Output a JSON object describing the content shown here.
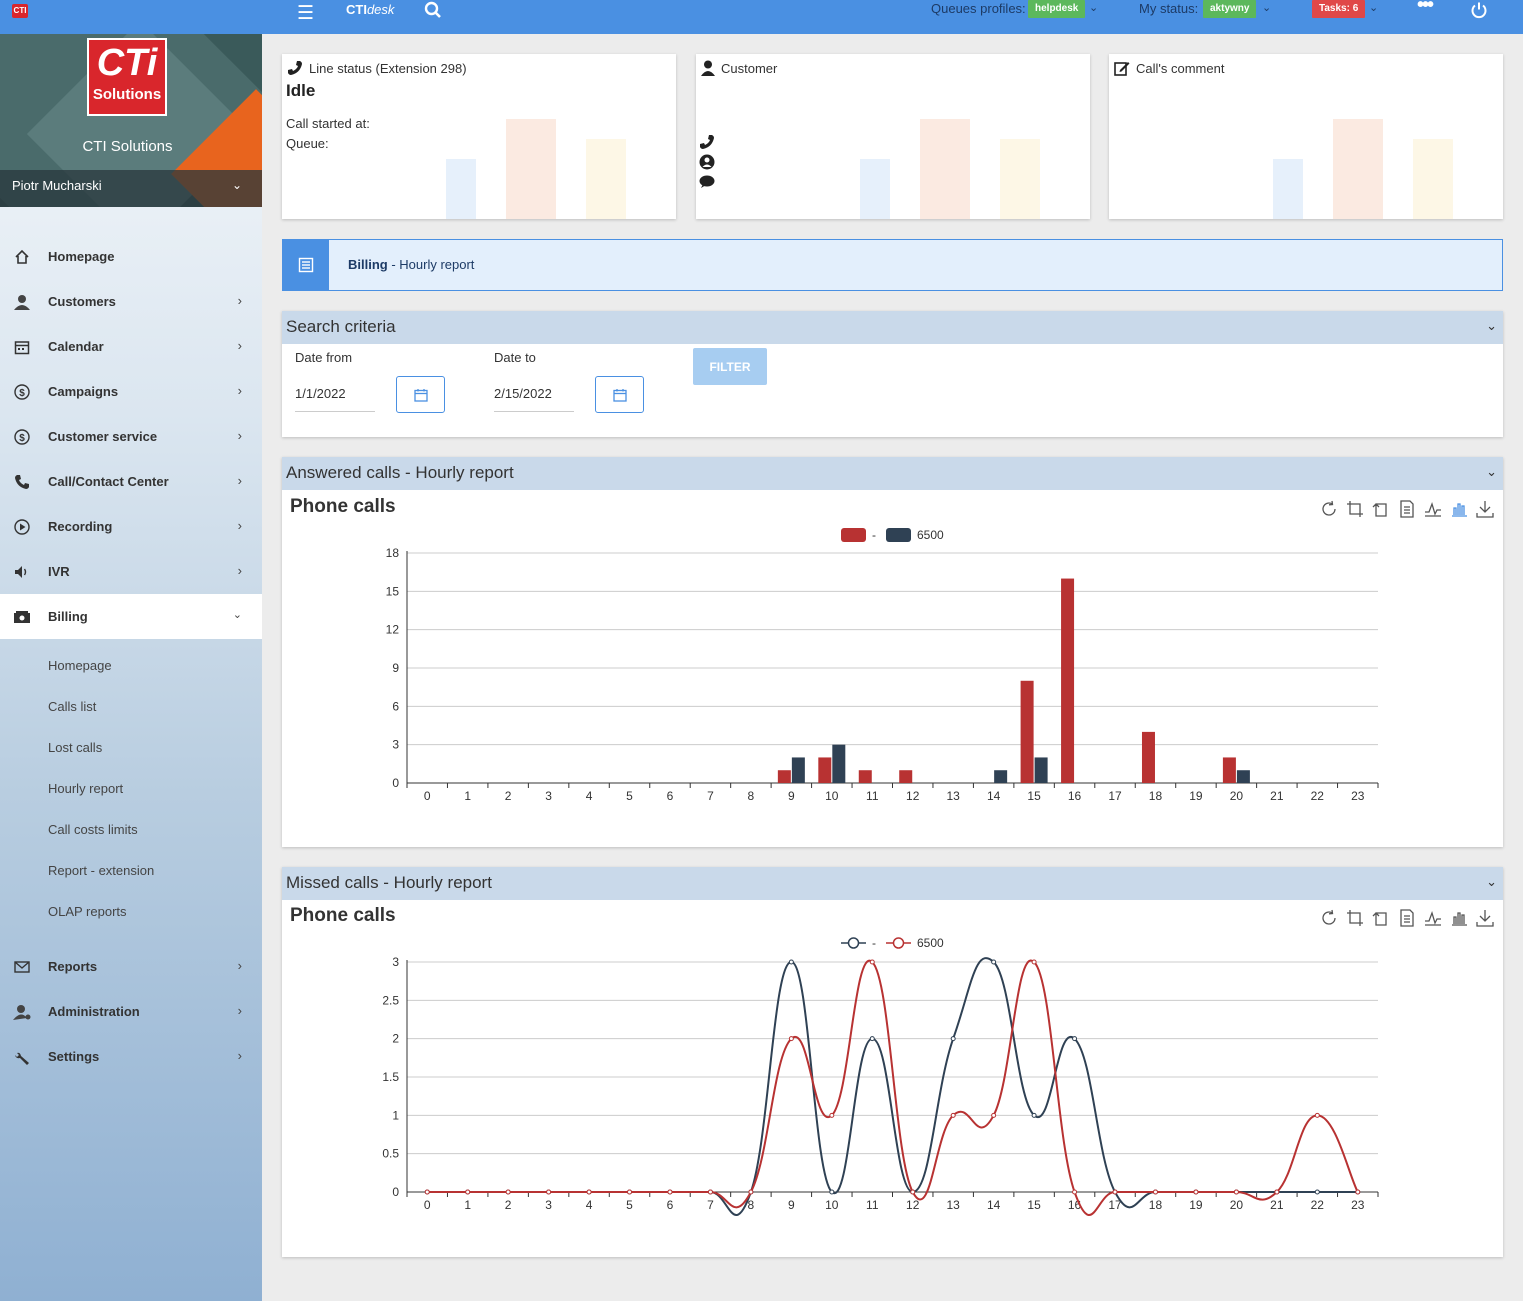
{
  "topbar": {
    "logo_text": "CTI",
    "brand_bold": "CTI",
    "brand_italic": "desk",
    "queues_label": "Queues profiles:",
    "queues_value": "helpdesk",
    "status_label": "My status:",
    "status_value": "aktywny",
    "tasks": "Tasks: 6",
    "colors": {
      "bar": "#4a90e2",
      "green": "#5cb85c",
      "red": "#e04848"
    }
  },
  "sidebar": {
    "logo_big": "CTi",
    "logo_small": "Solutions",
    "company": "CTI Solutions",
    "user": "Piotr Mucharski",
    "items": [
      {
        "label": "Homepage",
        "icon": "home-icon",
        "arrow": false
      },
      {
        "label": "Customers",
        "icon": "user-icon",
        "arrow": true
      },
      {
        "label": "Calendar",
        "icon": "calendar-icon",
        "arrow": true
      },
      {
        "label": "Campaigns",
        "icon": "dollar-icon",
        "arrow": true
      },
      {
        "label": "Customer service",
        "icon": "dollar-icon",
        "arrow": true
      },
      {
        "label": "Call/Contact Center",
        "icon": "phone-icon",
        "arrow": true
      },
      {
        "label": "Recording",
        "icon": "play-icon",
        "arrow": true
      },
      {
        "label": "IVR",
        "icon": "speaker-icon",
        "arrow": true
      },
      {
        "label": "Billing",
        "icon": "money-icon",
        "arrow": false
      }
    ],
    "billing_sub": [
      "Homepage",
      "Calls list",
      "Lost calls",
      "Hourly report",
      "Call costs limits",
      "Report - extension",
      "OLAP reports"
    ],
    "bottom_items": [
      {
        "label": "Reports",
        "icon": "mail-icon"
      },
      {
        "label": "Administration",
        "icon": "user-admin-icon"
      },
      {
        "label": "Settings",
        "icon": "wrench-icon"
      }
    ]
  },
  "cards": {
    "line_status_title": "Line status (Extension 298)",
    "line_status_value": "Idle",
    "call_started": "Call started at:",
    "queue": "Queue:",
    "customer_title": "Customer",
    "comment_title": "Call's comment"
  },
  "billing_bar": {
    "bold": "Billing",
    "rest": " - Hourly report"
  },
  "search": {
    "title": "Search criteria",
    "date_from_label": "Date from",
    "date_from": "1/1/2022",
    "date_to_label": "Date to",
    "date_to": "2/15/2022",
    "filter": "FILTER"
  },
  "answered": {
    "panel_title": "Answered calls - Hourly report",
    "chart_title": "Phone calls"
  },
  "missed": {
    "panel_title": "Missed calls - Hourly report",
    "chart_title": "Phone calls"
  },
  "chart_data": [
    {
      "type": "bar",
      "title": "Phone calls",
      "categories": [
        "0",
        "1",
        "2",
        "3",
        "4",
        "5",
        "6",
        "7",
        "8",
        "9",
        "10",
        "11",
        "12",
        "13",
        "14",
        "15",
        "16",
        "17",
        "18",
        "19",
        "20",
        "21",
        "22",
        "23"
      ],
      "series": [
        {
          "name": "-",
          "color": "#b83232",
          "values": [
            0,
            0,
            0,
            0,
            0,
            0,
            0,
            0,
            0,
            1,
            2,
            1,
            1,
            0,
            0,
            8,
            16,
            0,
            4,
            0,
            2,
            0,
            0,
            0
          ]
        },
        {
          "name": "6500",
          "color": "#2f4154",
          "values": [
            0,
            0,
            0,
            0,
            0,
            0,
            0,
            0,
            0,
            2,
            3,
            0,
            0,
            0,
            1,
            2,
            0,
            0,
            0,
            0,
            1,
            0,
            0,
            0
          ]
        }
      ],
      "yticks": [
        0,
        3,
        6,
        9,
        12,
        15,
        18
      ],
      "ylim": [
        0,
        18
      ],
      "legend": "top-center",
      "grid": true
    },
    {
      "type": "line",
      "title": "Phone calls",
      "categories": [
        "0",
        "1",
        "2",
        "3",
        "4",
        "5",
        "6",
        "7",
        "8",
        "9",
        "10",
        "11",
        "12",
        "13",
        "14",
        "15",
        "16",
        "17",
        "18",
        "19",
        "20",
        "21",
        "22",
        "23"
      ],
      "series": [
        {
          "name": "-",
          "color": "#2f4154",
          "values": [
            0,
            0,
            0,
            0,
            0,
            0,
            0,
            0,
            0,
            3,
            0,
            2,
            0,
            2,
            3,
            1,
            2,
            0,
            0,
            0,
            0,
            0,
            0,
            0
          ]
        },
        {
          "name": "6500",
          "color": "#b83232",
          "values": [
            0,
            0,
            0,
            0,
            0,
            0,
            0,
            0,
            0,
            2,
            1,
            3,
            0,
            1,
            1,
            3,
            0,
            0,
            0,
            0,
            0,
            0,
            1,
            0
          ]
        }
      ],
      "yticks": [
        "0",
        "0.5",
        "1",
        "1.5",
        "2",
        "2.5",
        "3"
      ],
      "ylim": [
        0,
        3
      ],
      "smooth": true,
      "legend": "top-center",
      "grid": true
    }
  ]
}
